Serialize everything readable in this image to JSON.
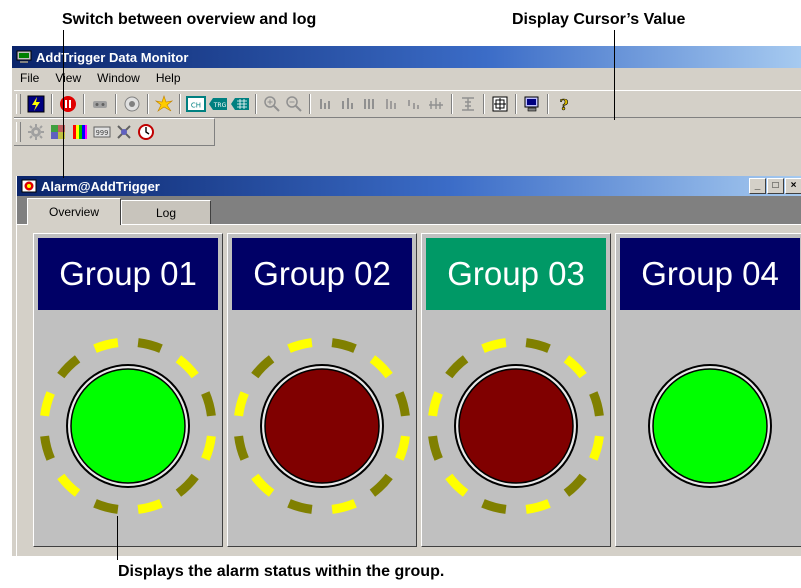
{
  "annotations": {
    "switch_tabs": "Switch between overview and log",
    "cursor_value": "Display Cursor’s Value",
    "alarm_status": "Displays the alarm status within the group."
  },
  "window": {
    "title": "AddTrigger Data Monitor",
    "menu": [
      "File",
      "View",
      "Window",
      "Help"
    ]
  },
  "toolbar": {
    "row1_icons": [
      "start-icon",
      "stop-icon",
      "record-icon",
      "target-icon",
      "burst-icon",
      "ch-display-icon",
      "trigger-display-icon",
      "grid-display-icon",
      "zoom-in-icon",
      "zoom-out-icon",
      "bars-icon-1",
      "bars-icon-2",
      "bars-icon-3",
      "bars-icon-4",
      "bars-icon-5",
      "bars-icon-6",
      "scale-icon",
      "cursor-value-icon",
      "monitor-icon",
      "help-icon"
    ],
    "row2_icons": [
      "gear-icon",
      "palette-icon",
      "color-bars-icon",
      "counter-icon",
      "cross-icon",
      "clock-icon"
    ]
  },
  "child_window": {
    "title": "Alarm@AddTrigger",
    "controls": [
      "_",
      "□",
      "×"
    ]
  },
  "tabs": [
    {
      "label": "Overview",
      "active": true
    },
    {
      "label": "Log",
      "active": false
    }
  ],
  "groups": [
    {
      "label": "Group 01",
      "header_color": "#000066",
      "lamp": "green",
      "ring": true
    },
    {
      "label": "Group 02",
      "header_color": "#000066",
      "lamp": "red",
      "ring": true
    },
    {
      "label": "Group 03",
      "header_color": "#009966",
      "lamp": "red",
      "ring": true
    },
    {
      "label": "Group 04",
      "header_color": "#000066",
      "lamp": "green",
      "ring": false
    }
  ],
  "colors": {
    "lamp_green": "#00ff00",
    "lamp_red": "#800000",
    "ring_yellow": "#ffff00",
    "ring_olive": "#808000"
  }
}
